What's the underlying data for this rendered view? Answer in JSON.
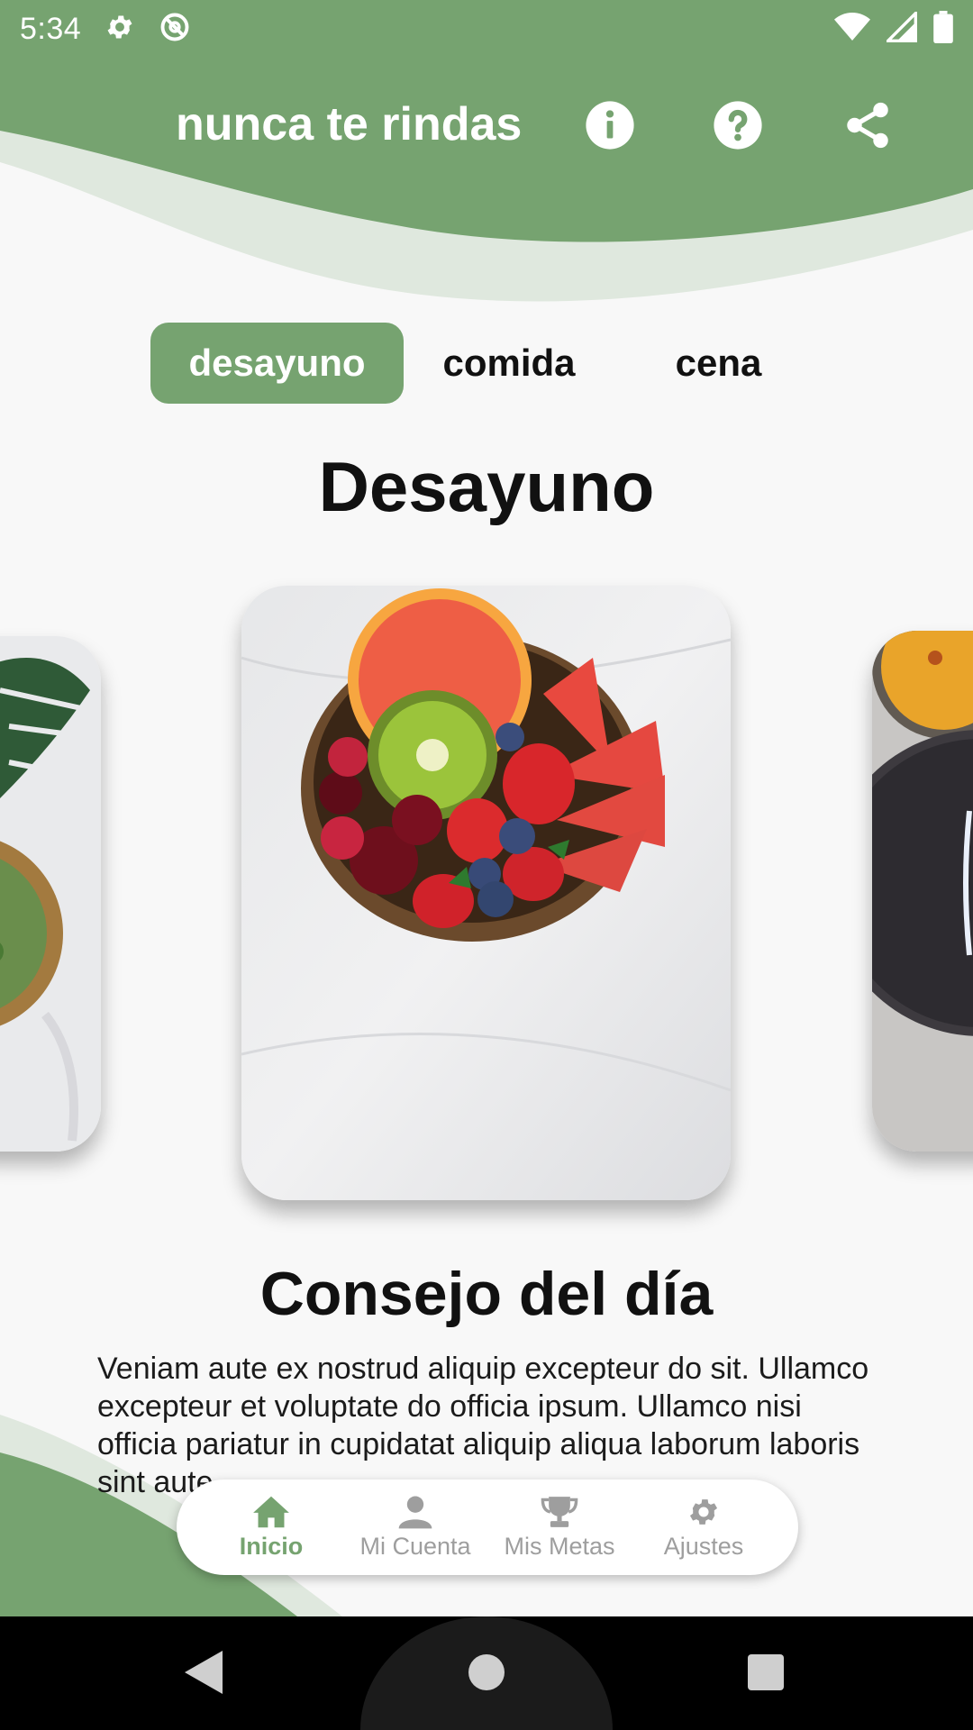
{
  "status_bar": {
    "time": "5:34",
    "icons_left": [
      "gear-icon",
      "no-disturb-icon"
    ],
    "icons_right": [
      "wifi-icon",
      "signal-icon",
      "battery-icon"
    ]
  },
  "header": {
    "title": "nunca te rindas",
    "actions": [
      "info-icon",
      "help-icon",
      "share-icon"
    ]
  },
  "tabs": [
    {
      "label": "desayuno",
      "active": true
    },
    {
      "label": "comida",
      "active": false
    },
    {
      "label": "cena",
      "active": false
    }
  ],
  "section_title": "Desayuno",
  "carousel": {
    "cards": [
      "green-salad-bowl",
      "fruit-coconut-bowl",
      "soup-bowl"
    ]
  },
  "tip": {
    "title": "Consejo del día",
    "body": "Veniam aute ex nostrud aliquip excepteur do sit. Ullamco excepteur et voluptate do officia ipsum. Ullamco nisi officia pariatur in cupidatat aliquip aliqua laborum laboris sint aute."
  },
  "bottom_nav": [
    {
      "label": "Inicio",
      "icon": "home-icon",
      "active": true
    },
    {
      "label": "Mi Cuenta",
      "icon": "person-icon",
      "active": false
    },
    {
      "label": "Mis Metas",
      "icon": "trophy-icon",
      "active": false
    },
    {
      "label": "Ajustes",
      "icon": "gear-icon",
      "active": false
    }
  ],
  "colors": {
    "accent": "#76a370",
    "accent_light": "#dfe8de",
    "inactive": "#9e9e9e"
  }
}
